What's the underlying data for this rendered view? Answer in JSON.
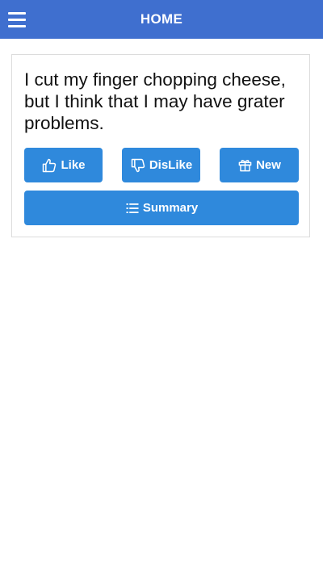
{
  "header": {
    "title": "HOME",
    "menu_icon": "hamburger-menu-icon"
  },
  "card": {
    "joke_text": "I cut my finger chopping cheese, but I think that I may have grater problems.",
    "buttons": {
      "like": {
        "label": "Like",
        "icon": "thumbs-up-icon"
      },
      "dislike": {
        "label": "DisLike",
        "icon": "thumbs-down-icon"
      },
      "new": {
        "label": "New",
        "icon": "gift-icon"
      },
      "summary": {
        "label": "Summary",
        "icon": "list-icon"
      }
    }
  },
  "colors": {
    "appbar": "#3f6fcf",
    "button": "#2f89dc"
  }
}
